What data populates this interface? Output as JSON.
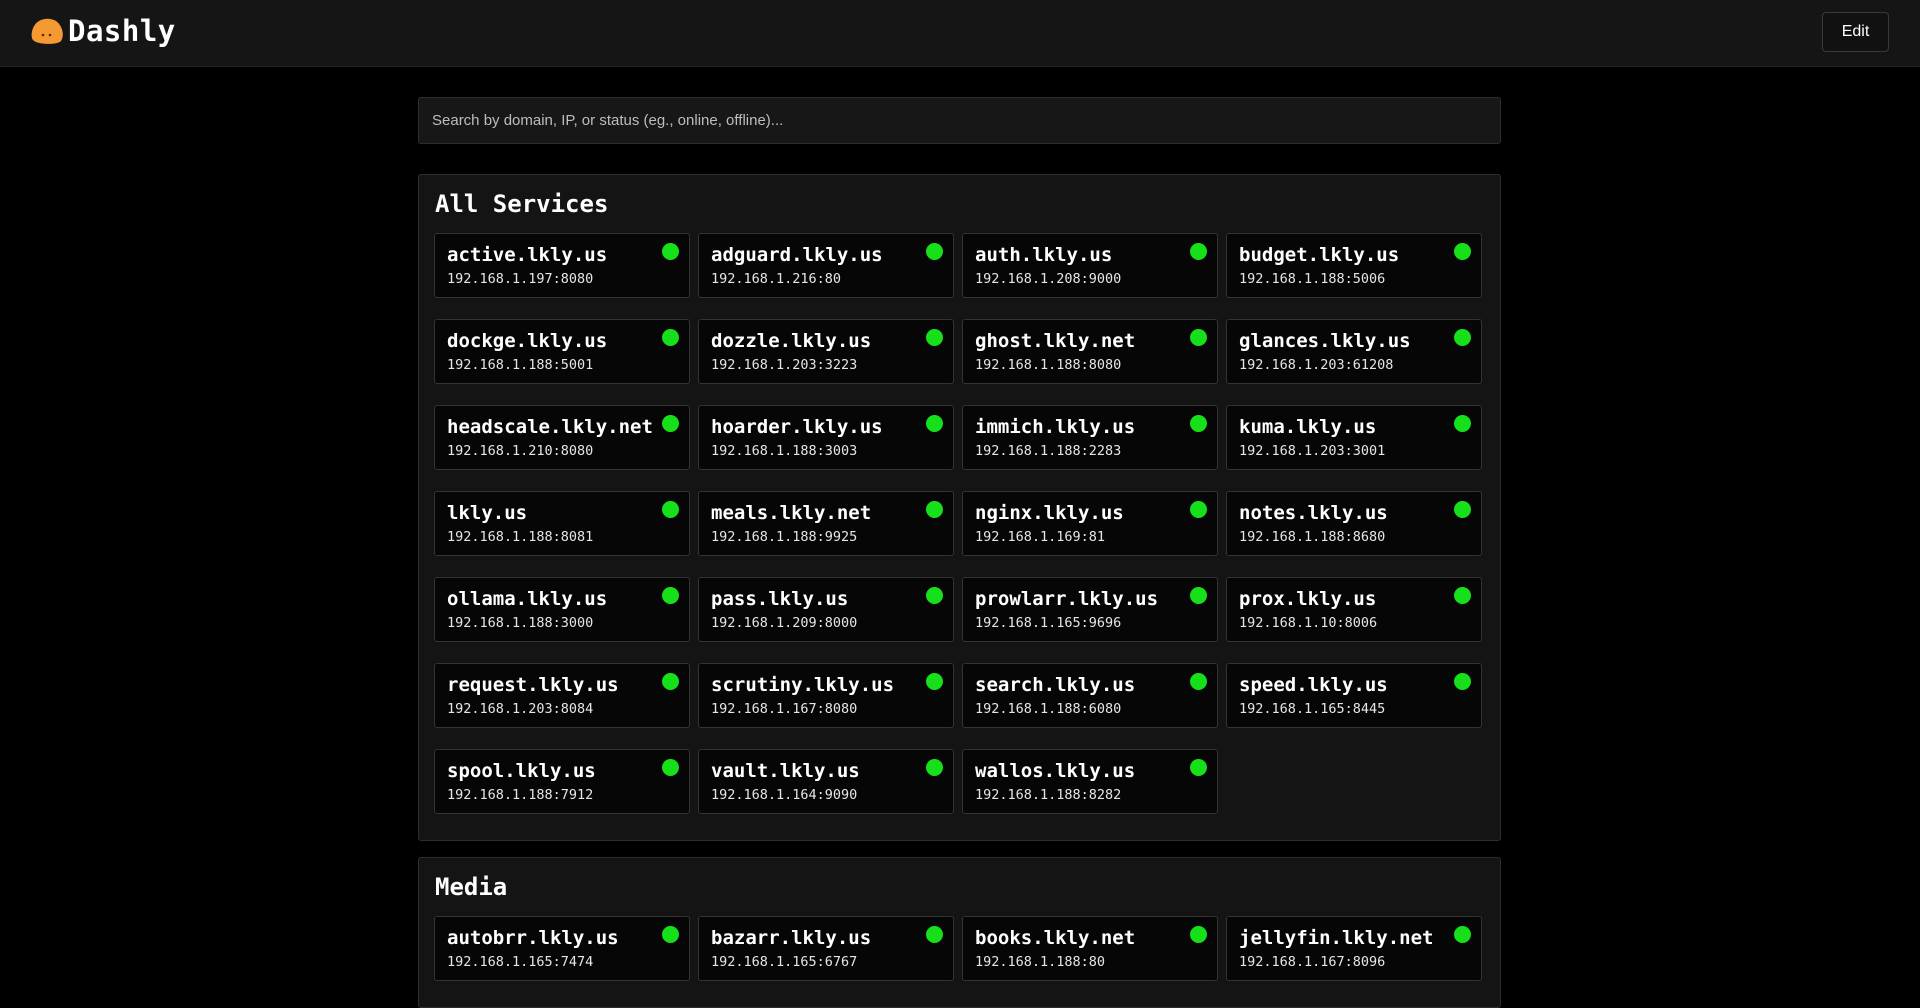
{
  "app": {
    "name": "Dashly",
    "logo_icon": "orange-blob-logo-icon",
    "edit_label": "Edit"
  },
  "search": {
    "placeholder": "Search by domain, IP, or status (eg., online, offline)...",
    "value": ""
  },
  "colors": {
    "online": "#16e01a",
    "logo": "#f59a33"
  },
  "sections": [
    {
      "title": "All Services",
      "services": [
        {
          "domain": "active.lkly.us",
          "address": "192.168.1.197:8080",
          "status": "online"
        },
        {
          "domain": "adguard.lkly.us",
          "address": "192.168.1.216:80",
          "status": "online"
        },
        {
          "domain": "auth.lkly.us",
          "address": "192.168.1.208:9000",
          "status": "online"
        },
        {
          "domain": "budget.lkly.us",
          "address": "192.168.1.188:5006",
          "status": "online"
        },
        {
          "domain": "dockge.lkly.us",
          "address": "192.168.1.188:5001",
          "status": "online"
        },
        {
          "domain": "dozzle.lkly.us",
          "address": "192.168.1.203:3223",
          "status": "online"
        },
        {
          "domain": "ghost.lkly.net",
          "address": "192.168.1.188:8080",
          "status": "online"
        },
        {
          "domain": "glances.lkly.us",
          "address": "192.168.1.203:61208",
          "status": "online"
        },
        {
          "domain": "headscale.lkly.net",
          "address": "192.168.1.210:8080",
          "status": "online"
        },
        {
          "domain": "hoarder.lkly.us",
          "address": "192.168.1.188:3003",
          "status": "online"
        },
        {
          "domain": "immich.lkly.us",
          "address": "192.168.1.188:2283",
          "status": "online"
        },
        {
          "domain": "kuma.lkly.us",
          "address": "192.168.1.203:3001",
          "status": "online"
        },
        {
          "domain": "lkly.us",
          "address": "192.168.1.188:8081",
          "status": "online"
        },
        {
          "domain": "meals.lkly.net",
          "address": "192.168.1.188:9925",
          "status": "online"
        },
        {
          "domain": "nginx.lkly.us",
          "address": "192.168.1.169:81",
          "status": "online"
        },
        {
          "domain": "notes.lkly.us",
          "address": "192.168.1.188:8680",
          "status": "online"
        },
        {
          "domain": "ollama.lkly.us",
          "address": "192.168.1.188:3000",
          "status": "online"
        },
        {
          "domain": "pass.lkly.us",
          "address": "192.168.1.209:8000",
          "status": "online"
        },
        {
          "domain": "prowlarr.lkly.us",
          "address": "192.168.1.165:9696",
          "status": "online"
        },
        {
          "domain": "prox.lkly.us",
          "address": "192.168.1.10:8006",
          "status": "online"
        },
        {
          "domain": "request.lkly.us",
          "address": "192.168.1.203:8084",
          "status": "online"
        },
        {
          "domain": "scrutiny.lkly.us",
          "address": "192.168.1.167:8080",
          "status": "online"
        },
        {
          "domain": "search.lkly.us",
          "address": "192.168.1.188:6080",
          "status": "online"
        },
        {
          "domain": "speed.lkly.us",
          "address": "192.168.1.165:8445",
          "status": "online"
        },
        {
          "domain": "spool.lkly.us",
          "address": "192.168.1.188:7912",
          "status": "online"
        },
        {
          "domain": "vault.lkly.us",
          "address": "192.168.1.164:9090",
          "status": "online"
        },
        {
          "domain": "wallos.lkly.us",
          "address": "192.168.1.188:8282",
          "status": "online"
        }
      ]
    },
    {
      "title": "Media",
      "services": [
        {
          "domain": "autobrr.lkly.us",
          "address": "192.168.1.165:7474",
          "status": "online"
        },
        {
          "domain": "bazarr.lkly.us",
          "address": "192.168.1.165:6767",
          "status": "online"
        },
        {
          "domain": "books.lkly.net",
          "address": "192.168.1.188:80",
          "status": "online"
        },
        {
          "domain": "jellyfin.lkly.net",
          "address": "192.168.1.167:8096",
          "status": "online"
        }
      ]
    }
  ]
}
